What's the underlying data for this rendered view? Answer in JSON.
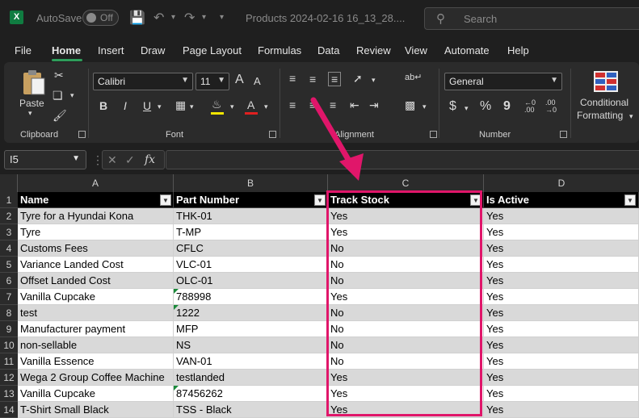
{
  "titlebar": {
    "autosave_label": "AutoSave",
    "autosave_state": "Off",
    "document_title": "Products 2024-02-16 16_13_28....",
    "search_placeholder": "Search"
  },
  "menu": {
    "tabs": [
      "File",
      "Home",
      "Insert",
      "Draw",
      "Page Layout",
      "Formulas",
      "Data",
      "Review",
      "View",
      "Automate",
      "Help"
    ],
    "active": "Home"
  },
  "ribbon": {
    "clipboard": {
      "paste_label": "Paste",
      "group_label": "Clipboard"
    },
    "font": {
      "font_name": "Calibri",
      "font_size": "11",
      "bold": "B",
      "italic": "I",
      "underline": "U",
      "grow": "A",
      "shrink": "A",
      "font_color_letter": "A",
      "group_label": "Font",
      "fill_color": "#f2e500",
      "font_color": "#e02020"
    },
    "alignment": {
      "group_label": "Alignment"
    },
    "number": {
      "format": "General",
      "currency": "$",
      "percent": "%",
      "comma": "9",
      "group_label": "Number"
    },
    "styles": {
      "conditional_line1": "Conditional",
      "conditional_line2": "Formatting"
    }
  },
  "formula_bar": {
    "name_box": "I5",
    "fx_label": "fx",
    "value": ""
  },
  "sheet": {
    "columns": [
      "A",
      "B",
      "C",
      "D"
    ],
    "header_row": {
      "num": "1",
      "cells": [
        "Name",
        "Part Number",
        "Track Stock",
        "Is Active"
      ]
    },
    "rows": [
      {
        "num": "2",
        "cells": [
          "Tyre for a Hyundai Kona",
          "THK-01",
          "Yes",
          "Yes"
        ],
        "note": false
      },
      {
        "num": "3",
        "cells": [
          "Tyre",
          "T-MP",
          "Yes",
          "Yes"
        ],
        "note": false
      },
      {
        "num": "4",
        "cells": [
          "Customs Fees",
          "CFLC",
          "No",
          "Yes"
        ],
        "note": false
      },
      {
        "num": "5",
        "cells": [
          "Variance Landed Cost",
          "VLC-01",
          "No",
          "Yes"
        ],
        "note": false
      },
      {
        "num": "6",
        "cells": [
          "Offset Landed Cost",
          "OLC-01",
          "No",
          "Yes"
        ],
        "note": false
      },
      {
        "num": "7",
        "cells": [
          "Vanilla Cupcake",
          "788998",
          "Yes",
          "Yes"
        ],
        "note": true
      },
      {
        "num": "8",
        "cells": [
          "test",
          "1222",
          "No",
          "Yes"
        ],
        "note": true
      },
      {
        "num": "9",
        "cells": [
          "Manufacturer payment",
          "MFP",
          "No",
          "Yes"
        ],
        "note": false
      },
      {
        "num": "10",
        "cells": [
          "non-sellable",
          "NS",
          "No",
          "Yes"
        ],
        "note": false
      },
      {
        "num": "11",
        "cells": [
          "Vanilla Essence",
          "VAN-01",
          "No",
          "Yes"
        ],
        "note": false
      },
      {
        "num": "12",
        "cells": [
          "Wega 2 Group Coffee Machine",
          "testlanded",
          "Yes",
          "Yes"
        ],
        "note": false
      },
      {
        "num": "13",
        "cells": [
          "Vanilla Cupcake",
          "87456262",
          "Yes",
          "Yes"
        ],
        "note": true
      },
      {
        "num": "14",
        "cells": [
          "T-Shirt Small Black",
          "TSS - Black",
          "Yes",
          "Yes"
        ],
        "note": false
      }
    ]
  },
  "annotation": {
    "color": "#e0166a",
    "highlighted_column": "C"
  }
}
